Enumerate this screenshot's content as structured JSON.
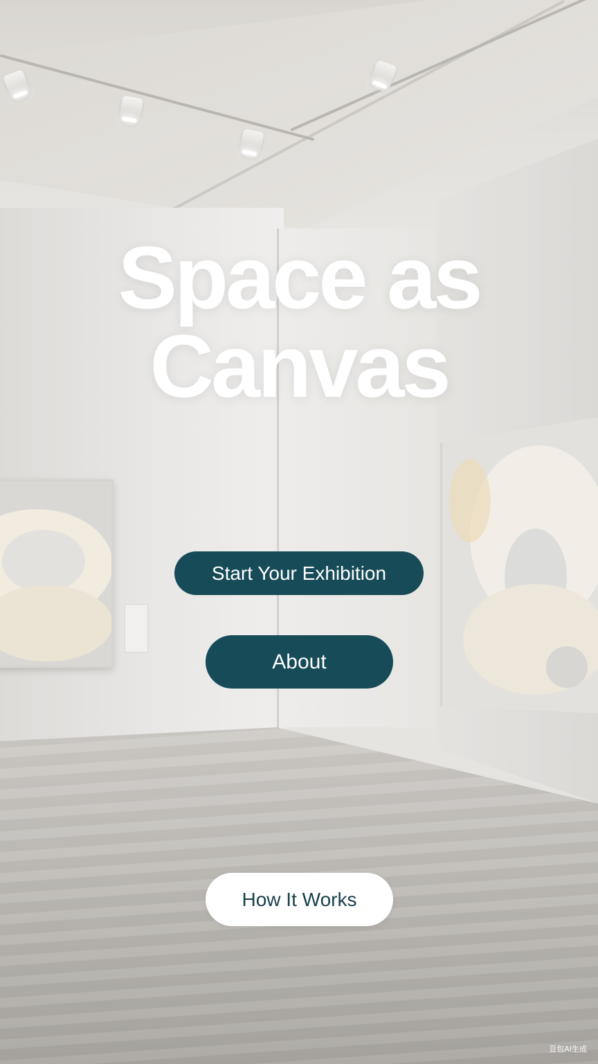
{
  "hero": {
    "title_line1": "Space as",
    "title_line2": "Canvas"
  },
  "actions": {
    "start_label": "Start Your Exhibition",
    "about_label": "About",
    "how_label": "How It Works"
  },
  "watermark": "豆包AI生成",
  "colors": {
    "primary_button": "#164b57",
    "secondary_button_bg": "#ffffff",
    "secondary_button_text": "#173f49",
    "title_text": "#ffffff"
  }
}
